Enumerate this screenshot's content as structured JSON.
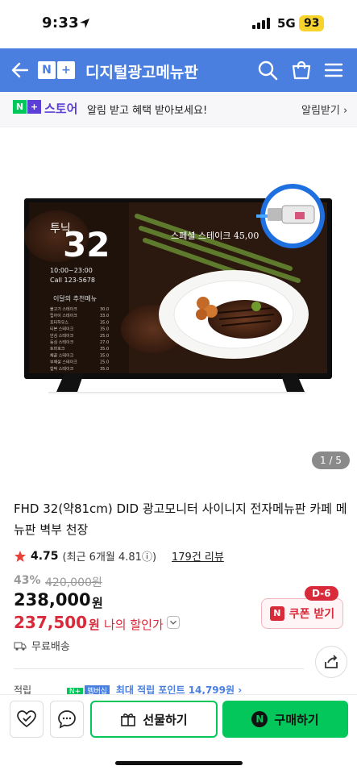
{
  "status": {
    "time": "9:33",
    "network": "5G",
    "battery": "93"
  },
  "nav": {
    "logo_n": "N",
    "logo_plus": "+",
    "title": "디지털광고메뉴판"
  },
  "banner": {
    "store_logo_n": "N",
    "store_logo_plus": "+",
    "store_name": "스토어",
    "message": "알림 받고 혜택 받아보세요!",
    "cta": "알림받기 ›"
  },
  "gallery": {
    "pager": "1 / 5"
  },
  "product": {
    "title": "FHD 32(약81cm) DID 광고모니터 사이니지 전자메뉴판 카페 메뉴판 벽부 천장",
    "rating": "4.75",
    "rating_recent": "(최근 6개월 4.81ⓘ)",
    "reviews": "179건 리뷰",
    "discount": "43%",
    "original_price": "420,000원",
    "price": "238,000",
    "price_unit": "원",
    "my_price": "237,500",
    "my_price_unit": "원",
    "my_price_label": "나의 할인가",
    "coupon_label": "쿠폰 받기",
    "coupon_dday": "D-6",
    "shipping": "무료배송"
  },
  "points": {
    "label": "적립",
    "np_tag": "N+",
    "membership_tag": "멤버십",
    "text": "최대 적립 포인트 14,799원 ›"
  },
  "bottom": {
    "gift": "선물하기",
    "buy": "구매하기",
    "buy_icon": "N"
  },
  "screen": {
    "big_number": "32",
    "hours": "10:00~23:00",
    "tel": "Call 123-5678",
    "menu_title": "이달의 추천메뉴",
    "special": "스페셜 스테이크 45,00",
    "menu_items": [
      {
        "name": "불고기 스테이크",
        "price": "30.0"
      },
      {
        "name": "립아이 스테이크",
        "price": "33.0"
      },
      {
        "name": "포터하우스",
        "price": "35.0"
      },
      {
        "name": "티본 스테이크",
        "price": "35.0"
      },
      {
        "name": "안심 스테이크",
        "price": "25.0"
      },
      {
        "name": "등심 스테이크",
        "price": "27.0"
      },
      {
        "name": "토마호크",
        "price": "35.0"
      },
      {
        "name": "채끝 스테이크",
        "price": "35.0"
      },
      {
        "name": "부채살 스테이크",
        "price": "25.0"
      },
      {
        "name": "함박 스테이크",
        "price": "35.0"
      }
    ]
  },
  "colors": {
    "nav": "#4a7fe0",
    "brand_green": "#03c75a",
    "sale_red": "#d92a3a",
    "store_purple": "#5b3fd6"
  },
  "icons": [
    "location-arrow-icon",
    "back-arrow-icon",
    "search-icon",
    "cart-icon",
    "menu-icon",
    "star-icon",
    "truck-icon",
    "share-icon",
    "heart-check-icon",
    "chat-icon",
    "gift-icon"
  ]
}
